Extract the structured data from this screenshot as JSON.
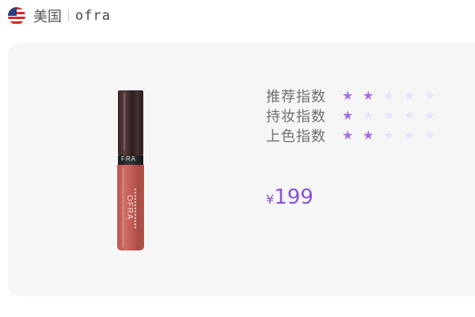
{
  "header": {
    "flag_icon": "us-flag-icon",
    "country": "美国",
    "brand": "ofra"
  },
  "product": {
    "image_icon": "lip-gloss-tube",
    "cap_label": "FRA",
    "tube_brand": "OFRA"
  },
  "ratings": [
    {
      "label": "推荐指数",
      "stars": 2,
      "max": 5
    },
    {
      "label": "持妆指数",
      "stars": 1,
      "max": 5
    },
    {
      "label": "上色指数",
      "stars": 2,
      "max": 5
    }
  ],
  "price": {
    "currency": "¥",
    "amount": "199"
  },
  "colors": {
    "accent": "#8a52d6",
    "star_on": "#a96be8",
    "star_off": "#ece2fb",
    "card_bg": "#f6f6f6"
  }
}
